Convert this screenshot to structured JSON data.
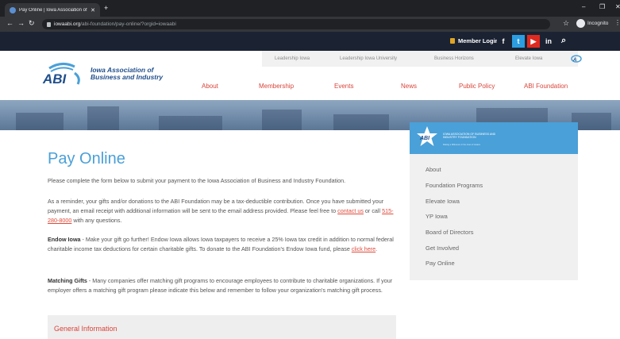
{
  "browser": {
    "tab_title": "Pay Online | Iowa Association of",
    "url_host": "iowaabi.org",
    "url_path": "/abi-foundation/pay-online/?orgid=iowaabi",
    "incognito_label": "Incognito"
  },
  "topbar": {
    "member_login": "Member Login",
    "social": {
      "fb": "f",
      "tw": "t",
      "yt": "▶",
      "in": "in"
    }
  },
  "header": {
    "logo_text": "ABI",
    "org_name": "Iowa Association of Business and Industry",
    "subnav": [
      "Leadership Iowa",
      "Leadership Iowa University",
      "Business Horizons",
      "Elevate Iowa"
    ],
    "mainnav": [
      "About",
      "Membership",
      "Events",
      "News",
      "Public Policy",
      "ABI Foundation"
    ]
  },
  "main": {
    "title": "Pay Online",
    "intro": "Please complete the form below to submit your payment to the Iowa Association of Business and Industry Foundation.",
    "reminder_a": "As a reminder, your gifts and/or donations to the ABI Foundation may be a tax-deductible contribution. Once you have submitted your payment, an email receipt with additional information will be sent to the email address provided. Please feel free to ",
    "contact_link": "contact us",
    "reminder_b": " or call ",
    "phone_link": "515-280-8000",
    "reminder_c": " with any questions.",
    "endow_label": "Endow Iowa",
    "endow_text": " - Make your gift go further! Endow Iowa allows Iowa taxpayers to receive a 25% Iowa tax credit in addition to normal federal charitable income tax deductions for certain charitable gifts. To donate to the ABI Foundation's Endow Iowa fund, please ",
    "endow_link": "click here",
    "endow_end": ".",
    "matching_label": "Matching Gifts",
    "matching_text": " - Many companies offer matching gift programs to encourage employees to contribute to charitable organizations. If your employer offers a matching gift program please indicate this below and remember to follow your organization's matching gift process.",
    "general_info": "General Information"
  },
  "sidebar": {
    "org_name": "IOWA ASSOCIATION OF BUSINESS AND INDUSTRY FOUNDATION",
    "tagline": "Making a Difference in the Lives of Iowans",
    "items": [
      "About",
      "Foundation Programs",
      "Elevate Iowa",
      "YP Iowa",
      "Board of Directors",
      "Get Involved",
      "Pay Online"
    ]
  },
  "colors": {
    "accent_blue": "#4aa0d8",
    "accent_red": "#d8453a",
    "navy": "#1b2333"
  }
}
